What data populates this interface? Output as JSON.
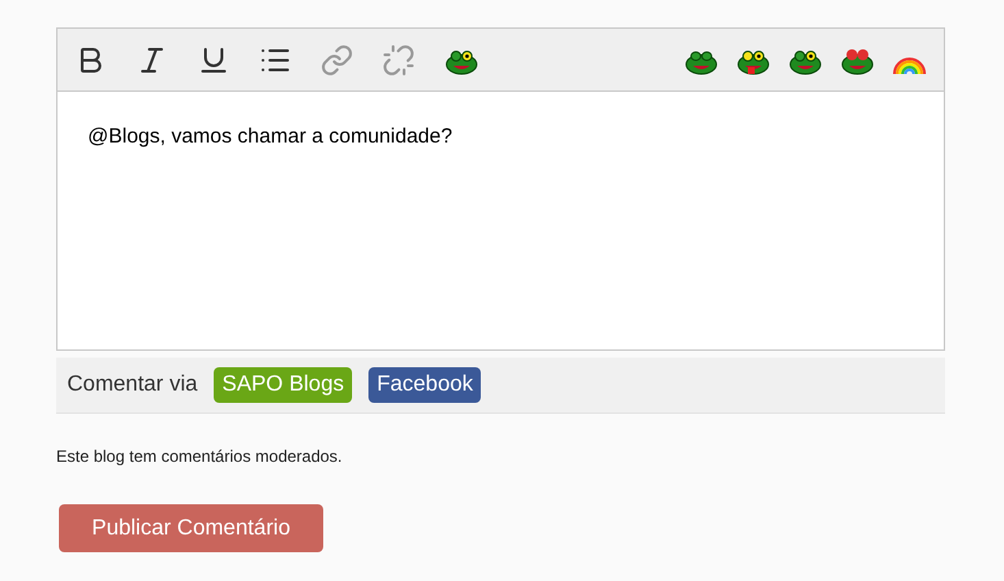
{
  "editor": {
    "text": "@Blogs, vamos chamar a comunidade?"
  },
  "comment_via": {
    "label": "Comentar via",
    "options": [
      {
        "label": "SAPO Blogs",
        "color": "#6aa716"
      },
      {
        "label": "Facebook",
        "color": "#3b5998"
      }
    ]
  },
  "notice": "Este blog tem comentários moderados.",
  "submit_button": "Publicar Comentário"
}
